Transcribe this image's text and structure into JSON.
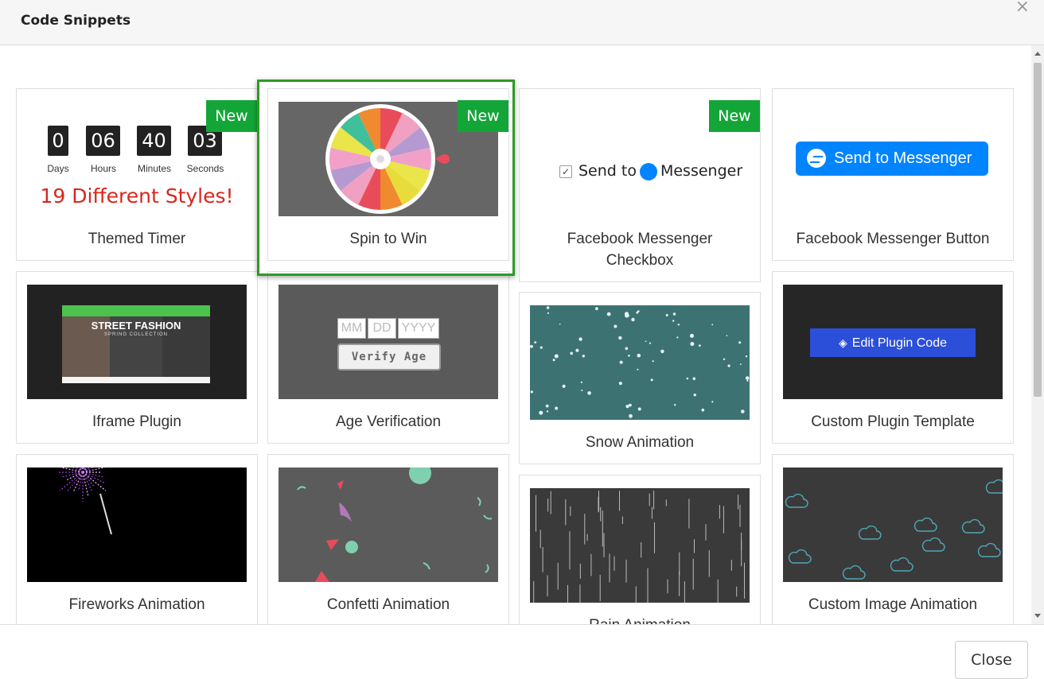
{
  "header": {
    "title": "Code Snippets",
    "close_symbol": "×"
  },
  "footer": {
    "close_label": "Close"
  },
  "badge_label": "New",
  "snippets": [
    {
      "label": "Themed Timer",
      "is_new": true,
      "timer": {
        "values": [
          "0",
          "06",
          "40",
          "03"
        ],
        "units": [
          "Days",
          "Hours",
          "Minutes",
          "Seconds"
        ],
        "styles_text": "19 Different Styles!"
      }
    },
    {
      "label": "Spin to Win",
      "is_new": true,
      "selected": true
    },
    {
      "label": "Facebook Messenger Checkbox",
      "is_new": true,
      "preview": {
        "send_to": "Send to",
        "messenger": "Messenger"
      }
    },
    {
      "label": "Facebook Messenger Button",
      "is_new": false,
      "preview": {
        "button_text": "Send to Messenger"
      }
    },
    {
      "label": "Iframe Plugin",
      "preview": {
        "headline": "STREET FASHION",
        "subhead": "SPRING COLLECTION"
      }
    },
    {
      "label": "Age Verification",
      "preview": {
        "mm": "MM",
        "dd": "DD",
        "yyyy": "YYYY",
        "verify": "Verify Age"
      }
    },
    {
      "label": "Snow Animation"
    },
    {
      "label": "Custom Plugin Template",
      "preview": {
        "button_text": "Edit Plugin Code"
      }
    },
    {
      "label": "Fireworks Animation"
    },
    {
      "label": "Confetti Animation"
    },
    {
      "label": "Rain Animation"
    },
    {
      "label": "Custom Image Animation"
    }
  ],
  "colors": {
    "badge": "#14a538",
    "selected_border": "#2e9a24",
    "messenger_blue": "#0084ff"
  }
}
